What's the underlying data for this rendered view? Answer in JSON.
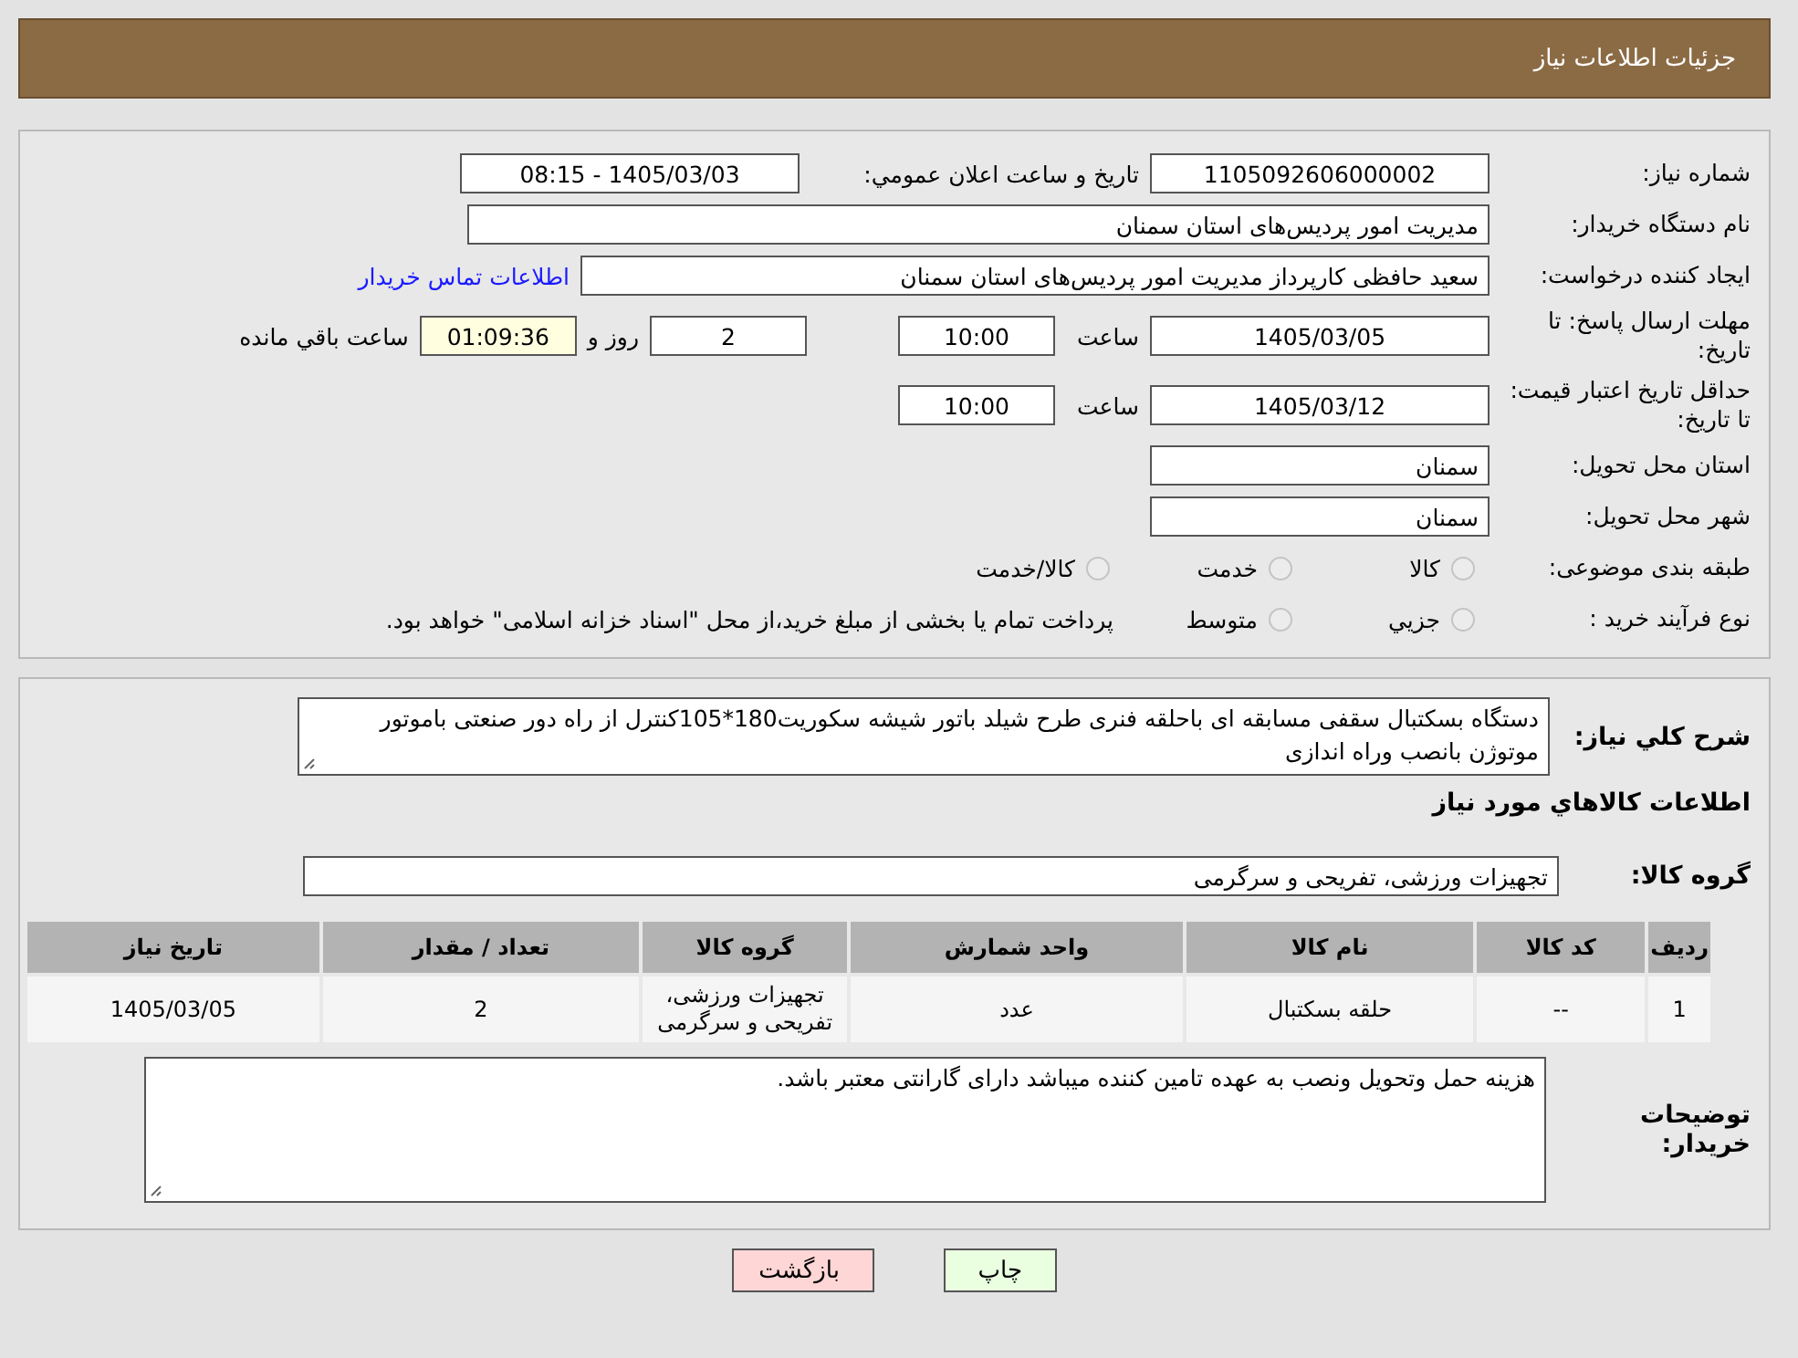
{
  "header": {
    "title": "جزئیات اطلاعات نیاز"
  },
  "need_number": {
    "label": "شماره نیاز:",
    "value": "1105092606000002"
  },
  "announce": {
    "label": "تاریخ و ساعت اعلان عمومي:",
    "value": "1405/03/03 - 08:15"
  },
  "buyer": {
    "label": "نام دستگاه خريدار:",
    "value": "مدیریت امور پردیس‌های استان سمنان"
  },
  "requester": {
    "label": "ایجاد کننده درخواست:",
    "value": "سعید حافظی کارپرداز مدیریت امور پردیس‌های استان سمنان",
    "link": "اطلاعات تماس خریدار"
  },
  "deadline": {
    "label": "مهلت ارسال پاسخ: تا تاریخ:",
    "date": "1405/03/05",
    "time_label": "ساعت",
    "time": "10:00",
    "days": "2",
    "days_label": "روز و",
    "remaining": "01:09:36",
    "remaining_label": "ساعت باقي مانده"
  },
  "validity": {
    "label": "حداقل تاریخ اعتبار قیمت: تا تاریخ:",
    "date": "1405/03/12",
    "time_label": "ساعت",
    "time": "10:00"
  },
  "province": {
    "label": "استان محل تحویل:",
    "value": "سمنان"
  },
  "city": {
    "label": "شهر محل تحویل:",
    "value": "سمنان"
  },
  "category": {
    "label": "طبقه بندی موضوعی:",
    "options": [
      {
        "label": "کالا",
        "selected": false
      },
      {
        "label": "خدمت",
        "selected": false
      },
      {
        "label": "کالا/خدمت",
        "selected": false
      }
    ]
  },
  "process": {
    "label": "نوع فرآیند خرید :",
    "options": [
      {
        "label": "جزيي",
        "selected": false
      },
      {
        "label": "متوسط",
        "selected": false
      }
    ],
    "note": "پرداخت تمام یا بخشی از مبلغ خرید،از محل \"اسناد خزانه اسلامی\" خواهد بود."
  },
  "description": {
    "label": "شرح کلي نياز:",
    "value": "دستگاه بسکتبال سقفی مسابقه ای باحلقه فنری طرح شیلد باتور شیشه سکوریت180*105کنترل از راه دور صنعتی باموتور موتوژن بانصب وراه اندازی"
  },
  "goods_title": "اطلاعات کالاهاي مورد نياز",
  "group": {
    "label": "گروه کالا:",
    "value": "تجهیزات ورزشی، تفریحی و سرگرمی"
  },
  "table": {
    "columns": [
      "ردیف",
      "کد کالا",
      "نام کالا",
      "واحد شمارش",
      "گروه کالا",
      "تعداد / مقدار",
      "تاریخ نیاز"
    ],
    "rows": [
      [
        "1",
        "--",
        "حلقه بسکتبال",
        "عدد",
        "تجهیزات ورزشی، تفریحی و سرگرمی",
        "2",
        "1405/03/05"
      ]
    ]
  },
  "notes": {
    "label": "توضیحات خریدار:",
    "value": "هزینه حمل وتحویل ونصب به عهده تامین کننده میباشد دارای گارانتی معتبر باشد."
  },
  "buttons": [
    {
      "label": "چاپ",
      "kind": "print"
    },
    {
      "label": "بازگشت",
      "kind": "back"
    }
  ]
}
